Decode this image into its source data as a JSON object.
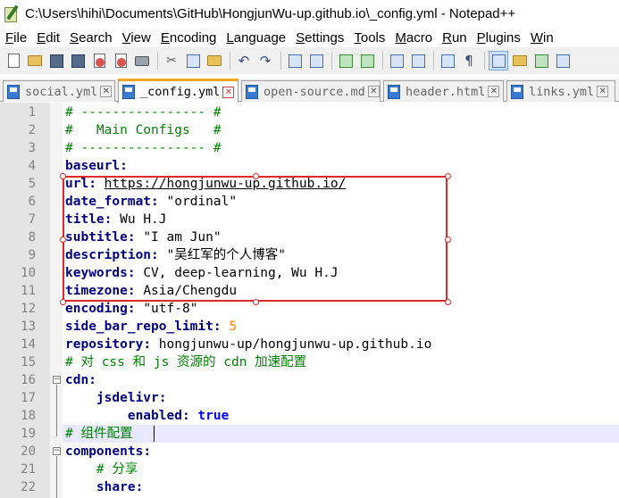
{
  "window": {
    "title": "C:\\Users\\hihi\\Documents\\GitHub\\HongjunWu-up.github.io\\_config.yml - Notepad++"
  },
  "menu": [
    {
      "ul": "F",
      "rest": "ile"
    },
    {
      "ul": "E",
      "rest": "dit"
    },
    {
      "ul": "S",
      "rest": "earch"
    },
    {
      "ul": "V",
      "rest": "iew"
    },
    {
      "ul": "E",
      "rest": "ncoding"
    },
    {
      "ul": "L",
      "rest": "anguage"
    },
    {
      "ul": "S",
      "rest": "ettings"
    },
    {
      "ul": "T",
      "rest": "ools"
    },
    {
      "ul": "M",
      "rest": "acro"
    },
    {
      "ul": "R",
      "rest": "un"
    },
    {
      "ul": "P",
      "rest": "lugins"
    },
    {
      "ul": "W",
      "rest": "in"
    }
  ],
  "tabs": [
    {
      "label": "social.yml",
      "active": false
    },
    {
      "label": "_config.yml",
      "active": true
    },
    {
      "label": "open-source.md",
      "active": false
    },
    {
      "label": "header.html",
      "active": false
    },
    {
      "label": "links.yml",
      "active": false
    }
  ],
  "close_glyph": "✕",
  "toolbar_glyphs": {
    "cut": "✂",
    "undo": "↶",
    "redo": "↷",
    "wrap": "¶"
  },
  "editor": {
    "current_line": 19,
    "lines": [
      {
        "n": "1",
        "segs": [
          [
            "c",
            "# ---------------- #"
          ]
        ]
      },
      {
        "n": "2",
        "segs": [
          [
            "c",
            "#   Main Configs   #"
          ]
        ]
      },
      {
        "n": "3",
        "segs": [
          [
            "c",
            "# ---------------- #"
          ]
        ]
      },
      {
        "n": "4",
        "segs": [
          [
            "k",
            "baseurl"
          ],
          [
            "k",
            ":"
          ]
        ]
      },
      {
        "n": "5",
        "segs": [
          [
            "k",
            "url"
          ],
          [
            "k",
            ": "
          ],
          [
            "u",
            "https://hongjunwu-up.github.io/"
          ]
        ]
      },
      {
        "n": "6",
        "segs": [
          [
            "k",
            "date_format"
          ],
          [
            "k",
            ": "
          ],
          [
            "s",
            "\"ordinal\""
          ]
        ]
      },
      {
        "n": "7",
        "segs": [
          [
            "k",
            "title"
          ],
          [
            "k",
            ": "
          ],
          [
            "s",
            "Wu H.J"
          ]
        ]
      },
      {
        "n": "8",
        "segs": [
          [
            "k",
            "subtitle"
          ],
          [
            "k",
            ": "
          ],
          [
            "s",
            "\"I am Jun\""
          ]
        ]
      },
      {
        "n": "9",
        "segs": [
          [
            "k",
            "description"
          ],
          [
            "k",
            ": "
          ],
          [
            "s",
            "\"吴红军的个人博客\""
          ]
        ]
      },
      {
        "n": "10",
        "segs": [
          [
            "k",
            "keywords"
          ],
          [
            "k",
            ": "
          ],
          [
            "s",
            "CV, deep-learning, Wu H.J"
          ]
        ]
      },
      {
        "n": "11",
        "segs": [
          [
            "k",
            "timezone"
          ],
          [
            "k",
            ": "
          ],
          [
            "s",
            "Asia/Chengdu"
          ]
        ]
      },
      {
        "n": "12",
        "segs": [
          [
            "k",
            "encoding"
          ],
          [
            "k",
            ": "
          ],
          [
            "s",
            "\"utf-8\""
          ]
        ]
      },
      {
        "n": "13",
        "segs": [
          [
            "k",
            "side_bar_repo_limit"
          ],
          [
            "k",
            ": "
          ],
          [
            "n",
            "5"
          ]
        ]
      },
      {
        "n": "14",
        "segs": [
          [
            "k",
            "repository"
          ],
          [
            "k",
            ": "
          ],
          [
            "s",
            "hongjunwu-up/hongjunwu-up.github.io"
          ]
        ]
      },
      {
        "n": "15",
        "segs": [
          [
            "c",
            "# 对 css 和 js 资源的 cdn 加速配置"
          ]
        ]
      },
      {
        "n": "16",
        "segs": [
          [
            "k",
            "cdn"
          ],
          [
            "k",
            ":"
          ]
        ]
      },
      {
        "n": "17",
        "segs": [
          [
            "s",
            "    "
          ],
          [
            "k",
            "jsdelivr"
          ],
          [
            "k",
            ":"
          ]
        ]
      },
      {
        "n": "18",
        "segs": [
          [
            "s",
            "        "
          ],
          [
            "k",
            "enabled"
          ],
          [
            "k",
            ": "
          ],
          [
            "b",
            "true"
          ]
        ]
      },
      {
        "n": "19",
        "segs": [
          [
            "c",
            "# 组件配置"
          ]
        ]
      },
      {
        "n": "20",
        "segs": [
          [
            "k",
            "components"
          ],
          [
            "k",
            ":"
          ]
        ]
      },
      {
        "n": "21",
        "segs": [
          [
            "s",
            "    "
          ],
          [
            "c",
            "# 分享"
          ]
        ]
      },
      {
        "n": "22",
        "segs": [
          [
            "s",
            "    "
          ],
          [
            "k",
            "share"
          ],
          [
            "k",
            ":"
          ]
        ]
      }
    ]
  }
}
